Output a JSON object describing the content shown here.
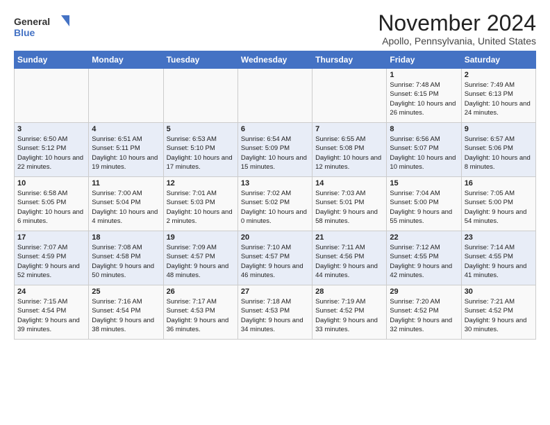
{
  "logo": {
    "line1": "General",
    "line2": "Blue"
  },
  "title": "November 2024",
  "location": "Apollo, Pennsylvania, United States",
  "days_of_week": [
    "Sunday",
    "Monday",
    "Tuesday",
    "Wednesday",
    "Thursday",
    "Friday",
    "Saturday"
  ],
  "weeks": [
    [
      {
        "day": "",
        "info": ""
      },
      {
        "day": "",
        "info": ""
      },
      {
        "day": "",
        "info": ""
      },
      {
        "day": "",
        "info": ""
      },
      {
        "day": "",
        "info": ""
      },
      {
        "day": "1",
        "info": "Sunrise: 7:48 AM\nSunset: 6:15 PM\nDaylight: 10 hours and 26 minutes."
      },
      {
        "day": "2",
        "info": "Sunrise: 7:49 AM\nSunset: 6:13 PM\nDaylight: 10 hours and 24 minutes."
      }
    ],
    [
      {
        "day": "3",
        "info": "Sunrise: 6:50 AM\nSunset: 5:12 PM\nDaylight: 10 hours and 22 minutes."
      },
      {
        "day": "4",
        "info": "Sunrise: 6:51 AM\nSunset: 5:11 PM\nDaylight: 10 hours and 19 minutes."
      },
      {
        "day": "5",
        "info": "Sunrise: 6:53 AM\nSunset: 5:10 PM\nDaylight: 10 hours and 17 minutes."
      },
      {
        "day": "6",
        "info": "Sunrise: 6:54 AM\nSunset: 5:09 PM\nDaylight: 10 hours and 15 minutes."
      },
      {
        "day": "7",
        "info": "Sunrise: 6:55 AM\nSunset: 5:08 PM\nDaylight: 10 hours and 12 minutes."
      },
      {
        "day": "8",
        "info": "Sunrise: 6:56 AM\nSunset: 5:07 PM\nDaylight: 10 hours and 10 minutes."
      },
      {
        "day": "9",
        "info": "Sunrise: 6:57 AM\nSunset: 5:06 PM\nDaylight: 10 hours and 8 minutes."
      }
    ],
    [
      {
        "day": "10",
        "info": "Sunrise: 6:58 AM\nSunset: 5:05 PM\nDaylight: 10 hours and 6 minutes."
      },
      {
        "day": "11",
        "info": "Sunrise: 7:00 AM\nSunset: 5:04 PM\nDaylight: 10 hours and 4 minutes."
      },
      {
        "day": "12",
        "info": "Sunrise: 7:01 AM\nSunset: 5:03 PM\nDaylight: 10 hours and 2 minutes."
      },
      {
        "day": "13",
        "info": "Sunrise: 7:02 AM\nSunset: 5:02 PM\nDaylight: 10 hours and 0 minutes."
      },
      {
        "day": "14",
        "info": "Sunrise: 7:03 AM\nSunset: 5:01 PM\nDaylight: 9 hours and 58 minutes."
      },
      {
        "day": "15",
        "info": "Sunrise: 7:04 AM\nSunset: 5:00 PM\nDaylight: 9 hours and 55 minutes."
      },
      {
        "day": "16",
        "info": "Sunrise: 7:05 AM\nSunset: 5:00 PM\nDaylight: 9 hours and 54 minutes."
      }
    ],
    [
      {
        "day": "17",
        "info": "Sunrise: 7:07 AM\nSunset: 4:59 PM\nDaylight: 9 hours and 52 minutes."
      },
      {
        "day": "18",
        "info": "Sunrise: 7:08 AM\nSunset: 4:58 PM\nDaylight: 9 hours and 50 minutes."
      },
      {
        "day": "19",
        "info": "Sunrise: 7:09 AM\nSunset: 4:57 PM\nDaylight: 9 hours and 48 minutes."
      },
      {
        "day": "20",
        "info": "Sunrise: 7:10 AM\nSunset: 4:57 PM\nDaylight: 9 hours and 46 minutes."
      },
      {
        "day": "21",
        "info": "Sunrise: 7:11 AM\nSunset: 4:56 PM\nDaylight: 9 hours and 44 minutes."
      },
      {
        "day": "22",
        "info": "Sunrise: 7:12 AM\nSunset: 4:55 PM\nDaylight: 9 hours and 42 minutes."
      },
      {
        "day": "23",
        "info": "Sunrise: 7:14 AM\nSunset: 4:55 PM\nDaylight: 9 hours and 41 minutes."
      }
    ],
    [
      {
        "day": "24",
        "info": "Sunrise: 7:15 AM\nSunset: 4:54 PM\nDaylight: 9 hours and 39 minutes."
      },
      {
        "day": "25",
        "info": "Sunrise: 7:16 AM\nSunset: 4:54 PM\nDaylight: 9 hours and 38 minutes."
      },
      {
        "day": "26",
        "info": "Sunrise: 7:17 AM\nSunset: 4:53 PM\nDaylight: 9 hours and 36 minutes."
      },
      {
        "day": "27",
        "info": "Sunrise: 7:18 AM\nSunset: 4:53 PM\nDaylight: 9 hours and 34 minutes."
      },
      {
        "day": "28",
        "info": "Sunrise: 7:19 AM\nSunset: 4:52 PM\nDaylight: 9 hours and 33 minutes."
      },
      {
        "day": "29",
        "info": "Sunrise: 7:20 AM\nSunset: 4:52 PM\nDaylight: 9 hours and 32 minutes."
      },
      {
        "day": "30",
        "info": "Sunrise: 7:21 AM\nSunset: 4:52 PM\nDaylight: 9 hours and 30 minutes."
      }
    ]
  ]
}
